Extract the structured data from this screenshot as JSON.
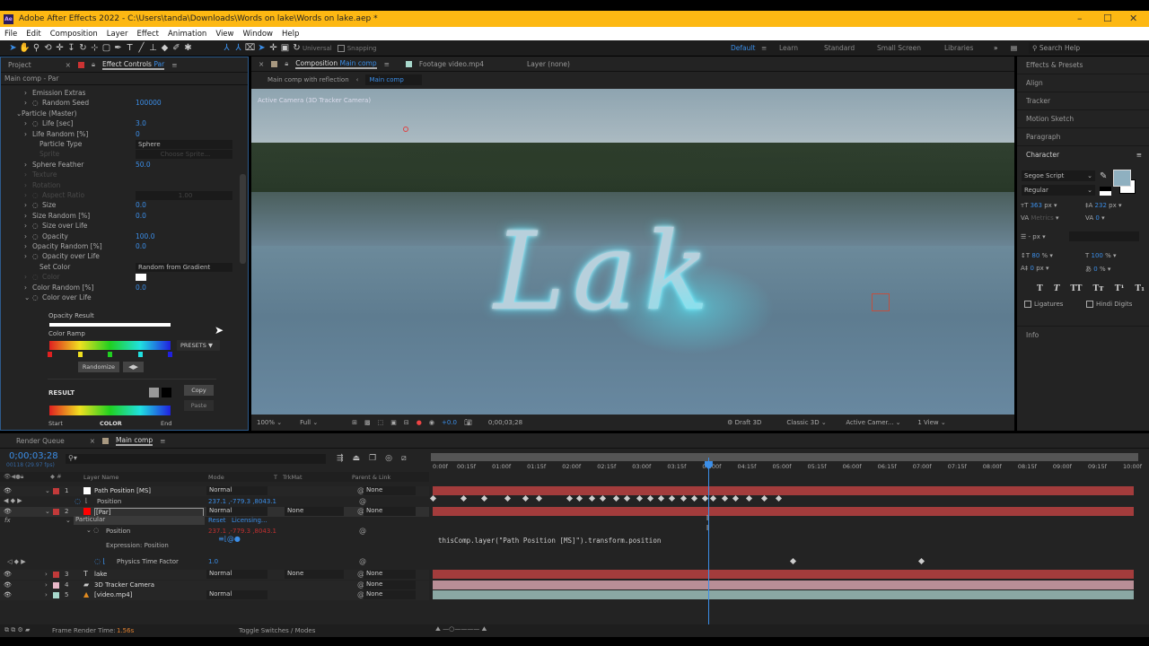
{
  "window": {
    "title": "Adobe After Effects 2022 - C:\\Users\\tanda\\Downloads\\Words on lake\\Words on lake.aep *",
    "logo": "Ae",
    "controls": [
      "–",
      "☐",
      "✕"
    ]
  },
  "menu": [
    "File",
    "Edit",
    "Composition",
    "Layer",
    "Effect",
    "Animation",
    "View",
    "Window",
    "Help"
  ],
  "toolbar": {
    "universal": "Universal",
    "snapping": "Snapping",
    "workspaces": [
      "Default",
      "Learn",
      "Standard",
      "Small Screen",
      "Libraries"
    ],
    "active_workspace": "Default",
    "search_placeholder": "Search Help"
  },
  "left_panel": {
    "tabs": [
      "Project",
      "Effect Controls"
    ],
    "effect_layer": "Par",
    "breadcrumb": "Main comp - Par",
    "props": [
      {
        "label": "Emission Extras",
        "value": "",
        "indent": 2,
        "state": "normal"
      },
      {
        "label": "Random Seed",
        "value": "100000",
        "indent": 2,
        "state": "stopwatch"
      },
      {
        "label": "Particle (Master)",
        "value": "",
        "indent": 1,
        "state": "open"
      },
      {
        "label": "Life [sec]",
        "value": "3.0",
        "indent": 2,
        "state": "stopwatch"
      },
      {
        "label": "Life Random [%]",
        "value": "0",
        "indent": 2,
        "state": "normal"
      },
      {
        "label": "Particle Type",
        "value": "Sphere",
        "indent": 3,
        "state": "dropdown"
      },
      {
        "label": "Sprite",
        "value": "Choose Sprite...",
        "indent": 3,
        "state": "disabled"
      },
      {
        "label": "Sphere Feather",
        "value": "50.0",
        "indent": 2,
        "state": "normal"
      },
      {
        "label": "Texture",
        "value": "",
        "indent": 2,
        "state": "disabled"
      },
      {
        "label": "Rotation",
        "value": "",
        "indent": 2,
        "state": "disabled"
      },
      {
        "label": "Aspect Ratio",
        "value": "1.00",
        "indent": 2,
        "state": "disabled"
      },
      {
        "label": "Size",
        "value": "0.0",
        "indent": 2,
        "state": "stopwatch"
      },
      {
        "label": "Size Random [%]",
        "value": "0.0",
        "indent": 2,
        "state": "normal"
      },
      {
        "label": "Size over Life",
        "value": "",
        "indent": 2,
        "state": "stopwatch"
      },
      {
        "label": "Opacity",
        "value": "100.0",
        "indent": 2,
        "state": "stopwatch"
      },
      {
        "label": "Opacity Random [%]",
        "value": "0.0",
        "indent": 2,
        "state": "normal"
      },
      {
        "label": "Opacity over Life",
        "value": "",
        "indent": 2,
        "state": "stopwatch"
      },
      {
        "label": "Set Color",
        "value": "Random from Gradient",
        "indent": 3,
        "state": "dropdown"
      },
      {
        "label": "Color",
        "value": "",
        "indent": 2,
        "state": "disabled"
      },
      {
        "label": "Color Random [%]",
        "value": "0.0",
        "indent": 2,
        "state": "normal"
      },
      {
        "label": "Color over Life",
        "value": "",
        "indent": 2,
        "state": "open-stopwatch"
      }
    ],
    "gradient": {
      "opacity_result": "Opacity Result",
      "color_ramp": "Color Ramp",
      "presets": "PRESETS",
      "randomize": "Randomize",
      "result": "RESULT",
      "copy": "Copy",
      "paste": "Paste",
      "start": "Start",
      "color": "COLOR",
      "end": "End",
      "stops": [
        "#e02020",
        "#f0e020",
        "#20d020",
        "#20e0e0",
        "#2020e0"
      ]
    }
  },
  "viewer": {
    "tabs": [
      "Composition",
      "Footage video.mp4",
      "Layer (none)"
    ],
    "comp_name": "Main comp",
    "breadcrumbs": [
      "Main comp with reflection",
      "Main comp"
    ],
    "camera_label": "Active Camera (3D Tracker Camera)",
    "overlay_text": "Lak",
    "bottom": {
      "zoom": "100%",
      "resolution": "Full",
      "exposure": "+0.0",
      "timecode": "0;00;03;28",
      "draft": "Draft 3D",
      "renderer": "Classic 3D",
      "camera": "Active Camer...",
      "views": "1 View"
    }
  },
  "right_panel": {
    "panels": [
      "Effects & Presets",
      "Align",
      "Tracker",
      "Motion Sketch",
      "Paragraph"
    ],
    "character": {
      "title": "Character",
      "font": "Segoe Script",
      "style": "Regular",
      "size": "363",
      "size_unit": "px",
      "leading": "232",
      "leading_unit": "px",
      "kerning": "Metrics",
      "tracking": "0",
      "stroke": "-",
      "stroke_unit": "px",
      "vscale": "80",
      "hscale": "100",
      "baseline": "0",
      "baseline_unit": "px",
      "tsume": "0",
      "pct": "%",
      "fill_color": "#8fb0c0",
      "styles": [
        "T",
        "T",
        "TT",
        "Tт",
        "T¹",
        "T₁"
      ],
      "ligatures": "Ligatures",
      "hindi": "Hindi Digits"
    },
    "info": "Info"
  },
  "timeline": {
    "tabs": [
      "Render Queue",
      "Main comp"
    ],
    "timecode": "0;00;03;28",
    "frame_info": "00118 (29.97 fps)",
    "columns": {
      "name": "Layer Name",
      "mode": "Mode",
      "t": "T",
      "trkmat": "TrkMat",
      "parent": "Parent & Link"
    },
    "ruler": [
      "0:00f",
      "00:15f",
      "01:00f",
      "01:15f",
      "02:00f",
      "02:15f",
      "03:00f",
      "03:15f",
      "04:00f",
      "04:15f",
      "05:00f",
      "05:15f",
      "06:00f",
      "06:15f",
      "07:00f",
      "07:15f",
      "08:00f",
      "08:15f",
      "09:00f",
      "09:15f",
      "10:00f"
    ],
    "duration_s": 10,
    "playhead_s": 3.93,
    "layers": [
      {
        "num": "1",
        "name": "Path Position [MS]",
        "label": "#c23a3a",
        "swatch": "#ffffff",
        "mode": "Normal",
        "trkmat": "",
        "parent": "None",
        "bar": "#a33c3c"
      },
      {
        "num": "2",
        "name": "[Par]",
        "label": "#c23a3a",
        "swatch": "#ff0000",
        "mode": "Normal",
        "trkmat": "None",
        "parent": "None",
        "bar": "#a33c3c"
      },
      {
        "num": "3",
        "name": "lake",
        "label": "#c23a3a",
        "swatch": "",
        "mode": "Normal",
        "trkmat": "None",
        "parent": "None",
        "bar": "#a33c3c"
      },
      {
        "num": "4",
        "name": "3D Tracker Camera",
        "label": "#e8b8c8",
        "swatch": "",
        "mode": "",
        "trkmat": "",
        "parent": "None",
        "bar": "#b88e96"
      },
      {
        "num": "5",
        "name": "[video.mp4]",
        "label": "#a8d8cc",
        "swatch": "",
        "mode": "Normal",
        "trkmat": "",
        "parent": "None",
        "bar": "#8aa8a4"
      }
    ],
    "position_label": "Position",
    "position_value": "237.1 ,-779.3 ,8043.1",
    "particular": "Particular",
    "reset": "Reset",
    "licensing": "Licensing...",
    "expression_label": "Expression: Position",
    "expression": "thisComp.layer(\"Path Position [MS]\").transform.position",
    "physics_label": "Physics Time Factor",
    "physics_value": "1.0",
    "position_keyframes_s": [
      0,
      0.44,
      0.73,
      1.06,
      1.32,
      1.51,
      1.94,
      2.09,
      2.26,
      2.42,
      2.61,
      2.77,
      2.94,
      3.1,
      3.25,
      3.41,
      3.57,
      3.72,
      3.88,
      3.99,
      4.16,
      4.31,
      4.51,
      4.72,
      4.93
    ],
    "physics_keyframes_s": [
      5.13,
      6.97
    ],
    "footer": {
      "render_label": "Frame Render Time:",
      "render_time": "1.56s",
      "toggle": "Toggle Switches / Modes"
    }
  }
}
